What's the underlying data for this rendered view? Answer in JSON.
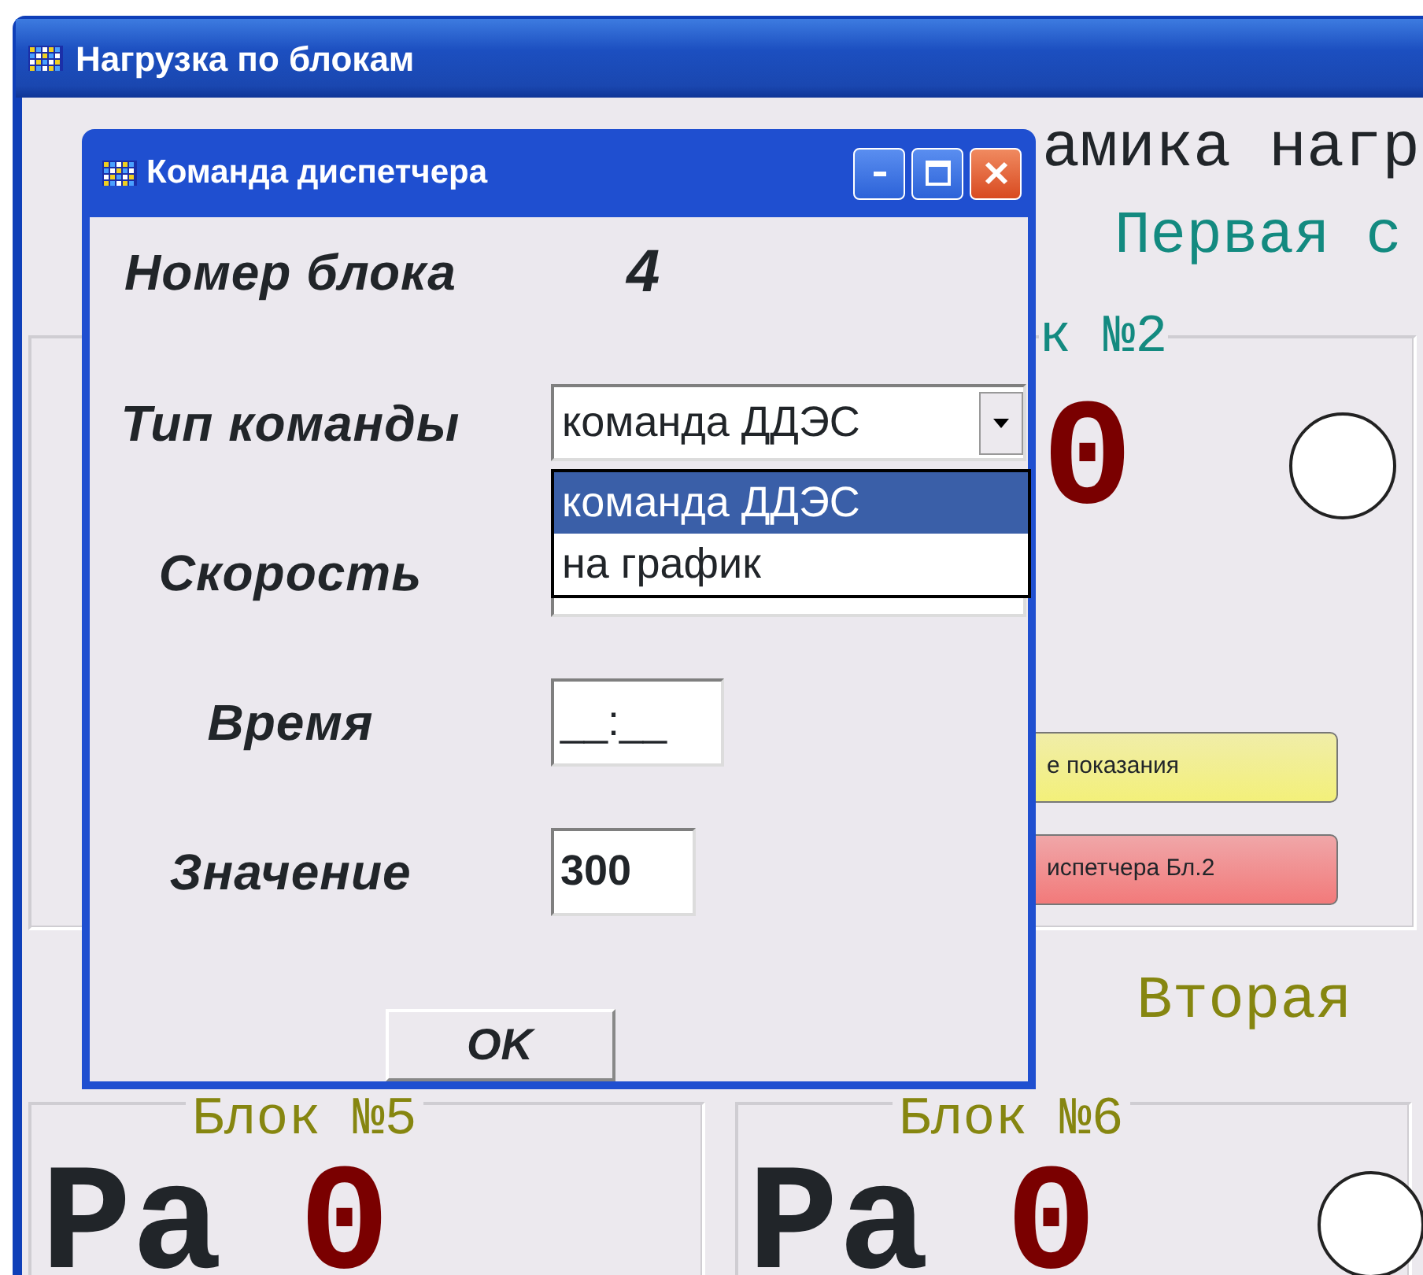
{
  "main_window": {
    "title": "Нагрузка по блокам"
  },
  "background": {
    "heading": "амика нагр",
    "first_section": "Первая с",
    "second_section": "Вторая",
    "block_top_right": {
      "label": "к №2",
      "reading_value": "0",
      "indicator": true,
      "buttons": [
        {
          "label": "е показания",
          "color": "#f3f07a"
        },
        {
          "label": "испетчера Бл.2",
          "color": "#f27a7a"
        }
      ]
    },
    "blocks_bottom": [
      {
        "label": "Блок №5",
        "reading_label": "Pa",
        "reading_value": "0",
        "indicator": false
      },
      {
        "label": "Блок №6",
        "reading_label": "Pa",
        "reading_value": "0",
        "indicator": true
      }
    ]
  },
  "dialog": {
    "title": "Команда диспетчера",
    "rows": [
      {
        "kind": "value",
        "label": "Номер блока",
        "value": "4"
      },
      {
        "kind": "combo",
        "label": "Тип команды",
        "value": "команда ДДЭС",
        "expanded": true,
        "options": [
          {
            "label": "команда ДДЭС",
            "selected": true
          },
          {
            "label": "на график",
            "selected": false
          }
        ]
      },
      {
        "kind": "field",
        "label": "Скорость"
      },
      {
        "kind": "field",
        "label": "Время",
        "value": "__:__"
      },
      {
        "kind": "field",
        "label": "Значение",
        "value": "300"
      }
    ],
    "ok_button": "OK"
  }
}
